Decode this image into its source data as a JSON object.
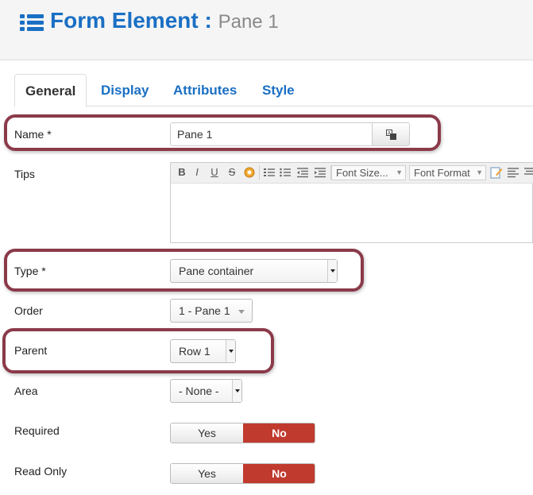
{
  "header": {
    "icon": "list-icon",
    "title": "Form Element :",
    "subtitle": "Pane 1",
    "title_color": "#1a6fc4"
  },
  "tabs": [
    {
      "label": "General",
      "active": true
    },
    {
      "label": "Display",
      "active": false
    },
    {
      "label": "Attributes",
      "active": false
    },
    {
      "label": "Style",
      "active": false
    }
  ],
  "fields": {
    "name": {
      "label": "Name *",
      "value": "Pane 1",
      "button_icon": "translate-icon"
    },
    "tips": {
      "label": "Tips",
      "toolbar": {
        "buttons": [
          "B",
          "I",
          "U",
          "S"
        ],
        "font_size": "Font Size...",
        "font_format": "Font Format"
      }
    },
    "type": {
      "label": "Type *",
      "value": "Pane container"
    },
    "order": {
      "label": "Order",
      "value": "1 - Pane 1"
    },
    "parent": {
      "label": "Parent",
      "value": "Row 1"
    },
    "area": {
      "label": "Area",
      "value": "- None -"
    },
    "required": {
      "label": "Required",
      "yes": "Yes",
      "no": "No",
      "selected": "No"
    },
    "read_only": {
      "label": "Read Only",
      "yes": "Yes",
      "no": "No",
      "selected": "No"
    }
  },
  "colors": {
    "accent": "#1a6fc4",
    "highlight_border": "#8b3a4a",
    "toggle_no": "#c13a2e"
  }
}
